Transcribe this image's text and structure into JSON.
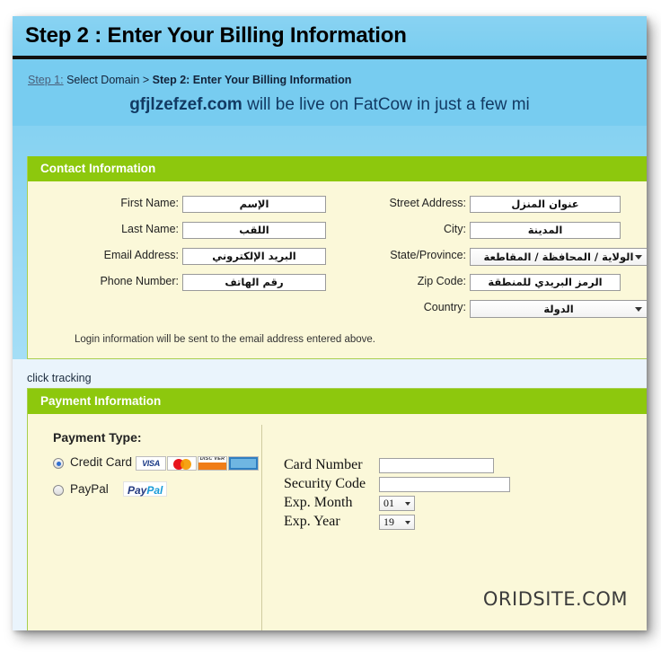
{
  "header": {
    "title": "Step 2 : Enter Your Billing Information",
    "breadcrumb_step1": "Step 1:",
    "breadcrumb_rest": " Select Domain > ",
    "breadcrumb_current": "Step 2: Enter Your Billing Information",
    "domain_name": "gfjlzefzef.com",
    "domain_message": " will be live on FatCow in just a few mi"
  },
  "contact": {
    "panel_title": "Contact Information",
    "left_fields": [
      {
        "label": "First Name:",
        "value": "الإسم"
      },
      {
        "label": "Last Name:",
        "value": "اللقب"
      },
      {
        "label": "Email Address:",
        "value": "البريد الإلكتروني"
      },
      {
        "label": "Phone Number:",
        "value": "رقم الهاتف"
      }
    ],
    "right_fields": [
      {
        "label": "Street Address:",
        "value": "عنوان المنزل",
        "type": "text"
      },
      {
        "label": "City:",
        "value": "المدينة",
        "type": "text"
      },
      {
        "label": "State/Province:",
        "value": "الولاية / المحافظة / المقاطعة",
        "type": "select"
      },
      {
        "label": "Zip Code:",
        "value": "الرمز البريدي للمنطقة",
        "type": "text"
      },
      {
        "label": "Country:",
        "value": "الدولة",
        "type": "select"
      }
    ],
    "note": "Login information will be sent to the email address entered above."
  },
  "click_tracking_label": "click tracking",
  "payment": {
    "panel_title": "Payment Information",
    "payment_type_title": "Payment Type:",
    "credit_card_label": "Credit Card",
    "paypal_label": "PayPal",
    "paypal_logo_1": "Pay",
    "paypal_logo_2": "Pal",
    "selected_type": "credit_card",
    "card_logos": [
      "VISA",
      "MasterCard",
      "DISCOVER",
      "American Express"
    ],
    "visa_text": "VISA",
    "discover_text": "DISC VER",
    "fields": [
      {
        "label": "Card Number",
        "value": "",
        "type": "text"
      },
      {
        "label": "Security Code",
        "value": "",
        "type": "text"
      },
      {
        "label": "Exp. Month",
        "value": "01",
        "type": "select"
      },
      {
        "label": "Exp. Year",
        "value": "19",
        "type": "select"
      }
    ]
  },
  "watermark": {
    "big": "ORIDSITE.COM",
    "small": "ORIDSITE.COM"
  },
  "colors": {
    "header_blue": "#77ccf0",
    "panel_green": "#8dc80d",
    "panel_cream": "#fbf8d9",
    "page_blue": "#eaf4fc"
  }
}
